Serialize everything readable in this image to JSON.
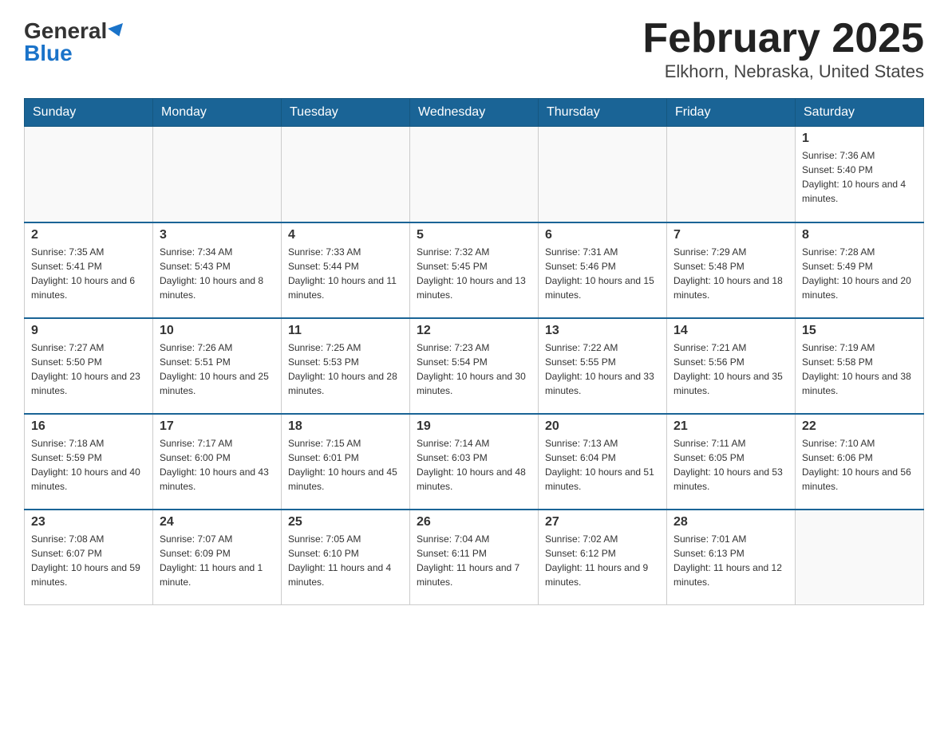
{
  "header": {
    "logo_general": "General",
    "logo_blue": "Blue",
    "title": "February 2025",
    "subtitle": "Elkhorn, Nebraska, United States"
  },
  "days_of_week": [
    "Sunday",
    "Monday",
    "Tuesday",
    "Wednesday",
    "Thursday",
    "Friday",
    "Saturday"
  ],
  "weeks": [
    {
      "days": [
        {
          "num": "",
          "info": ""
        },
        {
          "num": "",
          "info": ""
        },
        {
          "num": "",
          "info": ""
        },
        {
          "num": "",
          "info": ""
        },
        {
          "num": "",
          "info": ""
        },
        {
          "num": "",
          "info": ""
        },
        {
          "num": "1",
          "info": "Sunrise: 7:36 AM\nSunset: 5:40 PM\nDaylight: 10 hours and 4 minutes."
        }
      ]
    },
    {
      "days": [
        {
          "num": "2",
          "info": "Sunrise: 7:35 AM\nSunset: 5:41 PM\nDaylight: 10 hours and 6 minutes."
        },
        {
          "num": "3",
          "info": "Sunrise: 7:34 AM\nSunset: 5:43 PM\nDaylight: 10 hours and 8 minutes."
        },
        {
          "num": "4",
          "info": "Sunrise: 7:33 AM\nSunset: 5:44 PM\nDaylight: 10 hours and 11 minutes."
        },
        {
          "num": "5",
          "info": "Sunrise: 7:32 AM\nSunset: 5:45 PM\nDaylight: 10 hours and 13 minutes."
        },
        {
          "num": "6",
          "info": "Sunrise: 7:31 AM\nSunset: 5:46 PM\nDaylight: 10 hours and 15 minutes."
        },
        {
          "num": "7",
          "info": "Sunrise: 7:29 AM\nSunset: 5:48 PM\nDaylight: 10 hours and 18 minutes."
        },
        {
          "num": "8",
          "info": "Sunrise: 7:28 AM\nSunset: 5:49 PM\nDaylight: 10 hours and 20 minutes."
        }
      ]
    },
    {
      "days": [
        {
          "num": "9",
          "info": "Sunrise: 7:27 AM\nSunset: 5:50 PM\nDaylight: 10 hours and 23 minutes."
        },
        {
          "num": "10",
          "info": "Sunrise: 7:26 AM\nSunset: 5:51 PM\nDaylight: 10 hours and 25 minutes."
        },
        {
          "num": "11",
          "info": "Sunrise: 7:25 AM\nSunset: 5:53 PM\nDaylight: 10 hours and 28 minutes."
        },
        {
          "num": "12",
          "info": "Sunrise: 7:23 AM\nSunset: 5:54 PM\nDaylight: 10 hours and 30 minutes."
        },
        {
          "num": "13",
          "info": "Sunrise: 7:22 AM\nSunset: 5:55 PM\nDaylight: 10 hours and 33 minutes."
        },
        {
          "num": "14",
          "info": "Sunrise: 7:21 AM\nSunset: 5:56 PM\nDaylight: 10 hours and 35 minutes."
        },
        {
          "num": "15",
          "info": "Sunrise: 7:19 AM\nSunset: 5:58 PM\nDaylight: 10 hours and 38 minutes."
        }
      ]
    },
    {
      "days": [
        {
          "num": "16",
          "info": "Sunrise: 7:18 AM\nSunset: 5:59 PM\nDaylight: 10 hours and 40 minutes."
        },
        {
          "num": "17",
          "info": "Sunrise: 7:17 AM\nSunset: 6:00 PM\nDaylight: 10 hours and 43 minutes."
        },
        {
          "num": "18",
          "info": "Sunrise: 7:15 AM\nSunset: 6:01 PM\nDaylight: 10 hours and 45 minutes."
        },
        {
          "num": "19",
          "info": "Sunrise: 7:14 AM\nSunset: 6:03 PM\nDaylight: 10 hours and 48 minutes."
        },
        {
          "num": "20",
          "info": "Sunrise: 7:13 AM\nSunset: 6:04 PM\nDaylight: 10 hours and 51 minutes."
        },
        {
          "num": "21",
          "info": "Sunrise: 7:11 AM\nSunset: 6:05 PM\nDaylight: 10 hours and 53 minutes."
        },
        {
          "num": "22",
          "info": "Sunrise: 7:10 AM\nSunset: 6:06 PM\nDaylight: 10 hours and 56 minutes."
        }
      ]
    },
    {
      "days": [
        {
          "num": "23",
          "info": "Sunrise: 7:08 AM\nSunset: 6:07 PM\nDaylight: 10 hours and 59 minutes."
        },
        {
          "num": "24",
          "info": "Sunrise: 7:07 AM\nSunset: 6:09 PM\nDaylight: 11 hours and 1 minute."
        },
        {
          "num": "25",
          "info": "Sunrise: 7:05 AM\nSunset: 6:10 PM\nDaylight: 11 hours and 4 minutes."
        },
        {
          "num": "26",
          "info": "Sunrise: 7:04 AM\nSunset: 6:11 PM\nDaylight: 11 hours and 7 minutes."
        },
        {
          "num": "27",
          "info": "Sunrise: 7:02 AM\nSunset: 6:12 PM\nDaylight: 11 hours and 9 minutes."
        },
        {
          "num": "28",
          "info": "Sunrise: 7:01 AM\nSunset: 6:13 PM\nDaylight: 11 hours and 12 minutes."
        },
        {
          "num": "",
          "info": ""
        }
      ]
    }
  ]
}
